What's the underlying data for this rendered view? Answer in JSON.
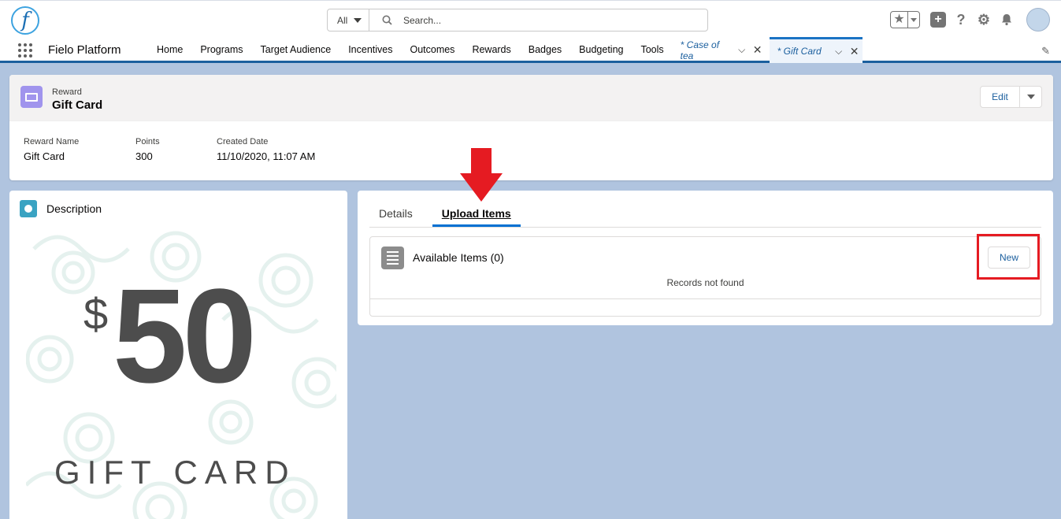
{
  "header": {
    "logo_glyph": "f",
    "search_scope": "All",
    "search_placeholder": "Search..."
  },
  "nav": {
    "app_name": "Fielo Platform",
    "items": [
      "Home",
      "Programs",
      "Target Audience",
      "Incentives",
      "Outcomes",
      "Rewards",
      "Badges",
      "Budgeting",
      "Tools"
    ],
    "tabs": [
      {
        "label": "* Case of tea",
        "active": false
      },
      {
        "label": "* Gift Card",
        "active": true
      }
    ]
  },
  "record": {
    "object_type": "Reward",
    "title": "Gift Card",
    "edit_label": "Edit",
    "fields": [
      {
        "label": "Reward Name",
        "value": "Gift Card"
      },
      {
        "label": "Points",
        "value": "300"
      },
      {
        "label": "Created Date",
        "value": "11/10/2020, 11:07 AM"
      }
    ]
  },
  "description": {
    "title": "Description",
    "image": {
      "currency": "$",
      "amount": "50",
      "caption": "GIFT CARD"
    }
  },
  "upload": {
    "tabs": [
      {
        "label": "Details",
        "active": false
      },
      {
        "label": "Upload Items",
        "active": true
      }
    ],
    "list_title": "Available Items (0)",
    "new_label": "New",
    "empty_message": "Records not found"
  },
  "colors": {
    "brand": "#1b5f9e",
    "annotation": "#e51b22",
    "background": "#b0c4df"
  }
}
